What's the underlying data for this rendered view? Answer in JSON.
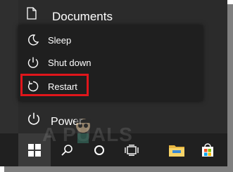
{
  "start_menu": {
    "header_item": {
      "label": "Documents",
      "icon": "document-icon"
    },
    "power_menu": [
      {
        "label": "Sleep",
        "icon": "moon-icon"
      },
      {
        "label": "Shut down",
        "icon": "power-icon"
      },
      {
        "label": "Restart",
        "icon": "restart-icon",
        "highlighted": true
      }
    ],
    "power_button": {
      "label": "Power",
      "icon": "power-icon"
    }
  },
  "taskbar": {
    "items": [
      {
        "name": "start",
        "icon": "windows-icon"
      },
      {
        "name": "search",
        "icon": "search-icon"
      },
      {
        "name": "cortana",
        "icon": "circle-icon"
      },
      {
        "name": "task-view",
        "icon": "task-view-icon"
      },
      {
        "name": "file-explorer",
        "icon": "folder-icon"
      },
      {
        "name": "store",
        "icon": "store-icon"
      }
    ]
  },
  "watermark": {
    "text": "A  PUALS"
  },
  "colors": {
    "highlight": "#e0161b",
    "menu_bg": "#1f1f1f",
    "taskbar_bg": "#202020"
  }
}
